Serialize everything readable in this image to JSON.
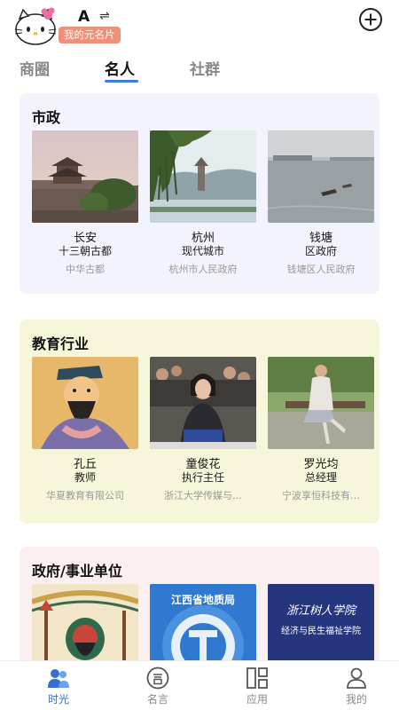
{
  "header": {
    "user_name": "A",
    "switch_icon": "⇌",
    "card_badge": "我的元名片",
    "avatar_icon": "hello-kitty-avatar",
    "add_icon": "plus-circle-icon"
  },
  "tabs": [
    {
      "label": "商圈",
      "active": false
    },
    {
      "label": "名人",
      "active": true
    },
    {
      "label": "社群",
      "active": false
    }
  ],
  "sections": [
    {
      "title": "市政",
      "background": "#f2f3fc",
      "items": [
        {
          "name": "长安",
          "subtitle": "十三朝古都",
          "org": "中华古都",
          "thumb": "gate-tower-photo"
        },
        {
          "name": "杭州",
          "subtitle": "现代城市",
          "org": "杭州市人民政府",
          "thumb": "lake-pagoda-photo"
        },
        {
          "name": "钱塘",
          "subtitle": "区政府",
          "org": "钱塘区人民政府",
          "thumb": "river-boats-photo"
        }
      ]
    },
    {
      "title": "教育行业",
      "background": "#f7f6da",
      "items": [
        {
          "name": "孔丘",
          "subtitle": "教师",
          "org": "华夏教育有限公司",
          "thumb": "confucius-portrait"
        },
        {
          "name": "童俊花",
          "subtitle": "执行主任",
          "org": "浙江大学传媒与…",
          "thumb": "speaker-photo"
        },
        {
          "name": "罗光均",
          "subtitle": "总经理",
          "org": "宁波享恒科技有…",
          "thumb": "park-person-photo"
        }
      ]
    },
    {
      "title": "政府/事业单位",
      "background": "#fbeff0",
      "items": [
        {
          "name": "",
          "subtitle": "",
          "org": "",
          "thumb": "guan-yu-illustration"
        },
        {
          "name": "",
          "subtitle": "",
          "org": "",
          "thumb": "geology-bureau-logo",
          "thumb_text": "江西省地质局"
        },
        {
          "name": "",
          "subtitle": "",
          "org": "",
          "thumb": "college-banner",
          "thumb_text": "浙江树人学院",
          "thumb_text2": "经济与民生福祉学院"
        }
      ]
    }
  ],
  "bottom_nav": [
    {
      "label": "时光",
      "icon": "people-icon",
      "active": true
    },
    {
      "label": "名言",
      "icon": "quote-circle-icon",
      "active": false
    },
    {
      "label": "应用",
      "icon": "grid-apps-icon",
      "active": false
    },
    {
      "label": "我的",
      "icon": "person-icon",
      "active": false
    }
  ]
}
